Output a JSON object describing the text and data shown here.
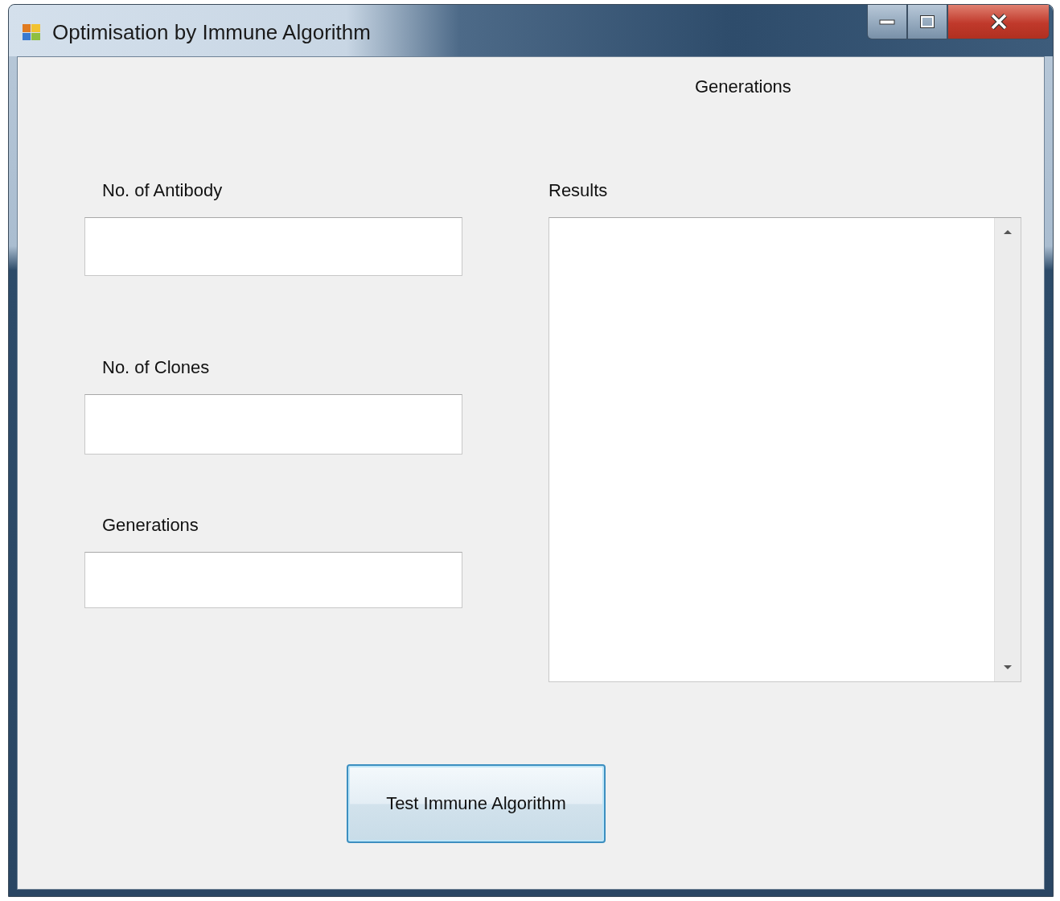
{
  "window": {
    "title": "Optimisation by Immune Algorithm"
  },
  "header_label": "Generations",
  "fields": [
    {
      "label": "No. of Antibody"
    },
    {
      "label": "No. of Clones"
    },
    {
      "label": "Generations"
    }
  ],
  "results": {
    "label": "Results"
  },
  "buttons": [
    {
      "label": "Test Immune Algorithm"
    }
  ]
}
